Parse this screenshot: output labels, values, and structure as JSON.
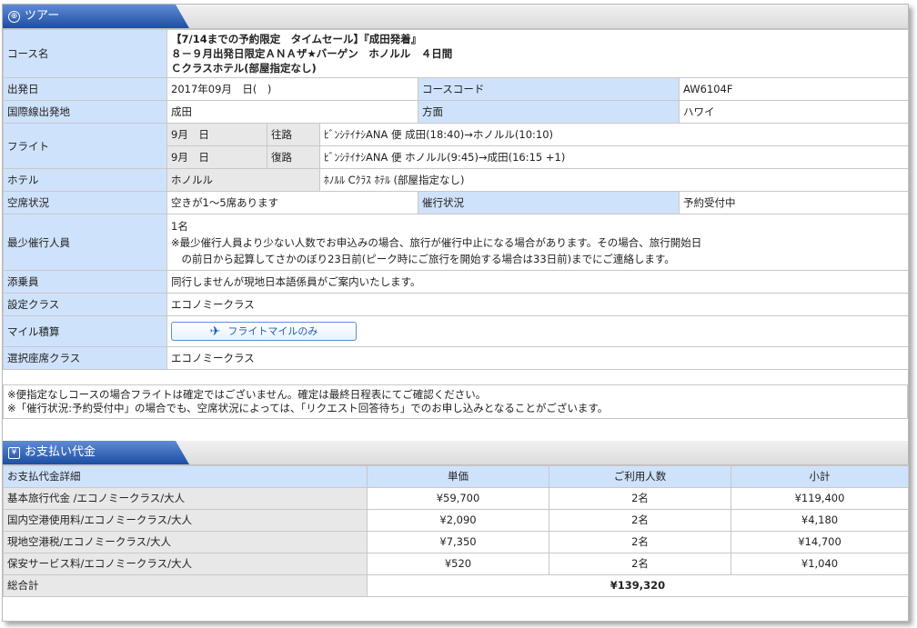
{
  "tour_section": {
    "title": "ツアー",
    "icon": "globe-icon",
    "rows": {
      "course_name": {
        "label": "コース名",
        "line1": "【7/14までの予約限定　タイムセール】『成田発着』",
        "line2": "８－９月出発日限定ＡＮＡザ★バーゲン　ホノルル　４日間",
        "line3": "Ｃクラスホテル(部屋指定なし)"
      },
      "departure": {
        "label": "出発日",
        "value": "2017年09月　日(　)",
        "code_label": "コースコード",
        "code_value": "AW6104F"
      },
      "airport": {
        "label": "国際線出発地",
        "value": "成田",
        "dest_label": "方面",
        "dest_value": "ハワイ"
      },
      "flight": {
        "label": "フライト",
        "outbound": {
          "date": "9月　日",
          "dir": "往路",
          "detail": "ﾋﾞﾝｼﾃｲﾅｼANA 便 成田(18:40)→ホノルル(10:10)"
        },
        "return": {
          "date": "9月　日",
          "dir": "復路",
          "detail": "ﾋﾞﾝｼﾃｲﾅｼANA 便 ホノルル(9:45)→成田(16:15 +1)"
        }
      },
      "hotel": {
        "label": "ホテル",
        "city": "ホノルル",
        "name": "ﾎﾉﾙﾙ Cｸﾗｽ ﾎﾃﾙ (部屋指定なし)"
      },
      "seats": {
        "label": "空席状況",
        "value": "空きが1～5席あります",
        "status_label": "催行状況",
        "status_value": "予約受付中"
      },
      "min_people": {
        "label": "最少催行人員",
        "count": "1名",
        "note1": "※最少催行人員より少ない人数でお申込みの場合、旅行が催行中止になる場合があります。その場合、旅行開始日",
        "note2": "　の前日から起算してさかのぼり23日前(ピーク時にご旅行を開始する場合は33日前)までにご連絡します。"
      },
      "conductor": {
        "label": "添乗員",
        "value": "同行しませんが現地日本語係員がご案内いたします。"
      },
      "class": {
        "label": "設定クラス",
        "value": "エコノミークラス"
      },
      "mileage": {
        "label": "マイル積算",
        "button": "フライトマイルのみ",
        "icon": "airplane-icon"
      },
      "seat_class": {
        "label": "選択座席クラス",
        "value": "エコノミークラス"
      }
    },
    "notes": [
      "※便指定なしコースの場合フライトは確定ではございません。確定は最終日程表にてご確認ください。",
      "※「催行状況:予約受付中」の場合でも、空席状況によっては、「リクエスト回答待ち」でのお申し込みとなることがございます。"
    ]
  },
  "payment_section": {
    "title": "お支払い代金",
    "icon": "yen-icon",
    "headers": [
      "お支払代金詳細",
      "単価",
      "ご利用人数",
      "小計"
    ],
    "rows": [
      [
        "基本旅行代金 /エコノミークラス/大人",
        "¥59,700",
        "2名",
        "¥119,400"
      ],
      [
        "国内空港使用料/エコノミークラス/大人",
        "¥2,090",
        "2名",
        "¥4,180"
      ],
      [
        "現地空港税/エコノミークラス/大人",
        "¥7,350",
        "2名",
        "¥14,700"
      ],
      [
        "保安サービス料/エコノミークラス/大人",
        "¥520",
        "2名",
        "¥1,040"
      ]
    ],
    "total_label": "総合計",
    "total_value": "¥139,320"
  },
  "colors": {
    "header_blue": "#1d4ea3",
    "label_bg": "#cfe2fb",
    "sub_bg": "#e8e8e8"
  }
}
